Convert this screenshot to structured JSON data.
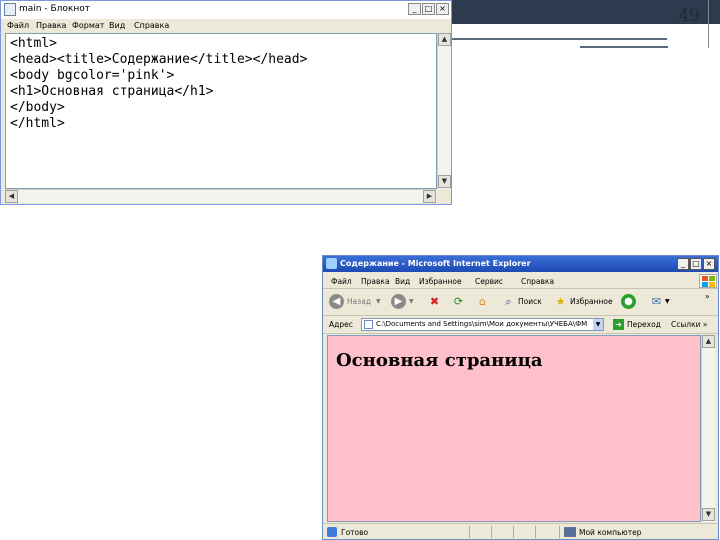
{
  "slide": {
    "page_number": "49"
  },
  "notepad": {
    "title": "main - Блокнот",
    "window_buttons": [
      "_",
      "□",
      "×"
    ],
    "menu": [
      "Файл",
      "Правка",
      "Формат",
      "Вид",
      "Справка"
    ],
    "code_lines": [
      "<html>",
      "<head><title>Содержание</title></head>",
      "<body bgcolor='pink'>",
      "<h1>Основная страница</h1>",
      "</body>",
      "</html>"
    ]
  },
  "browser": {
    "title": "Содержание - Microsoft Internet Explorer",
    "window_buttons": [
      "_",
      "□",
      "×"
    ],
    "menu": [
      "Файл",
      "Правка",
      "Вид",
      "Избранное",
      "Сервис",
      "Справка"
    ],
    "toolbar": {
      "back": "Назад",
      "search": "Поиск",
      "favorites": "Избранное",
      "more": "»"
    },
    "address_label": "Адрес",
    "address_value": "C:\\Documents and Settings\\sim\\Мои документы\\УЧЕБА\\ФМ",
    "go_label": "Переход",
    "links_label": "Ссылки",
    "links_more": "»",
    "page_heading": "Основная страница",
    "page_background": "#ffc0cb",
    "status_text": "Готово",
    "zone_text": "Мой компьютер"
  },
  "colors": {
    "title_bar": "#1d4ab3",
    "pink": "#ffc0cb",
    "slide_bar": "#2e3b4e"
  }
}
